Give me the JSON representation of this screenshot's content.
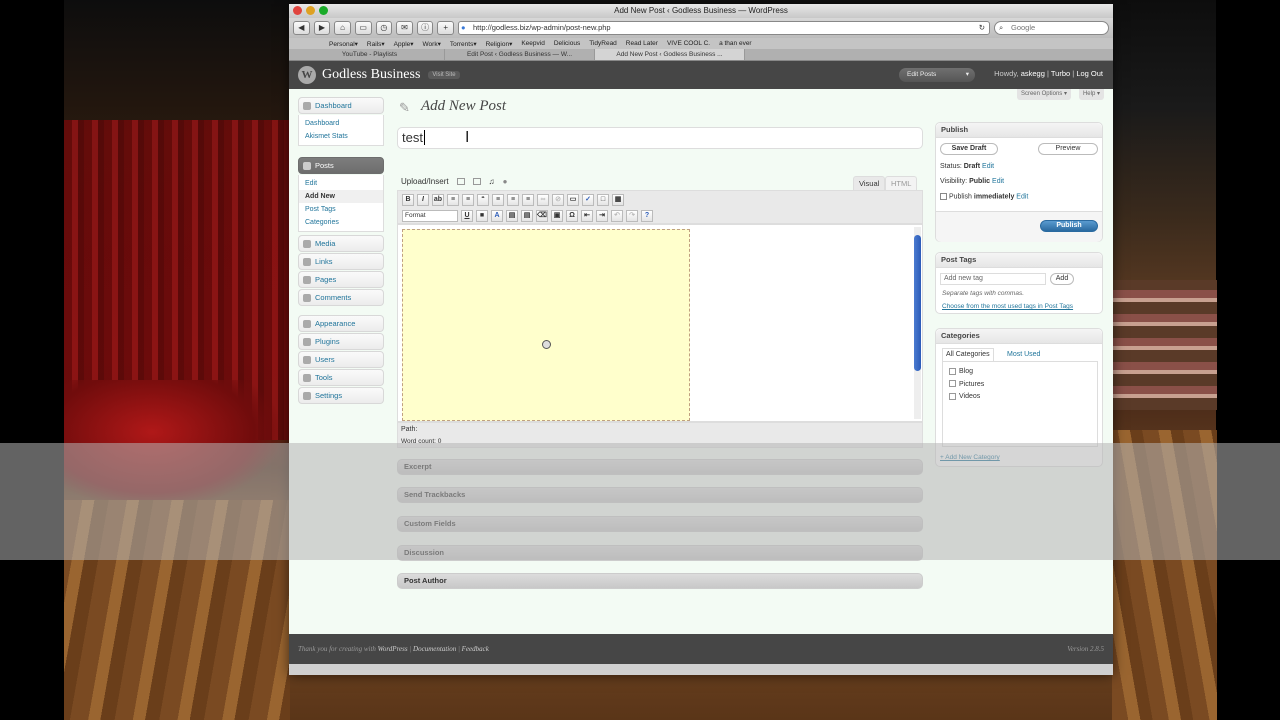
{
  "browser": {
    "window_title": "Add New Post ‹ Godless Business — WordPress",
    "url": "http://godless.biz/wp-admin/post-new.php",
    "search_placeholder": "Google",
    "bookmarks": [
      "Personal▾",
      "Rails▾",
      "Apple▾",
      "Work▾",
      "Torrents▾",
      "Religion▾",
      "Keepvid",
      "Delicious",
      "TidyRead",
      "Read Later",
      "VIVE COOL C.",
      "a than ever"
    ],
    "tabs": [
      "YouTube - Playlists",
      "Edit Post ‹ Godless Business — W...",
      "Add New Post ‹ Godless Business ..."
    ]
  },
  "wp_header": {
    "logo": "W",
    "site_name": "Godless Business",
    "visit_site": "Visit Site",
    "favorite_action": "Edit Posts",
    "howdy": "Howdy,",
    "user": "askegg",
    "turbo": "Turbo",
    "logout": "Log Out"
  },
  "screen_options": {
    "screen_options": "Screen Options ▾",
    "help": "Help ▾"
  },
  "menu": {
    "dashboard": "Dashboard",
    "dashboard_sub": [
      "Dashboard",
      "Akismet Stats"
    ],
    "posts": "Posts",
    "posts_sub": [
      "Edit",
      "Add New",
      "Post Tags",
      "Categories"
    ],
    "items_a": [
      "Media",
      "Links",
      "Pages",
      "Comments"
    ],
    "items_b": [
      "Appearance",
      "Plugins",
      "Users",
      "Tools",
      "Settings"
    ]
  },
  "editor": {
    "page_title": "Add New Post",
    "title_value": "test",
    "upload_insert": "Upload/Insert",
    "visual_tab": "Visual",
    "html_tab": "HTML",
    "format_select": "Format",
    "path_label": "Path:",
    "word_count": "Word count: 0"
  },
  "closed_boxes": [
    "Excerpt",
    "Send Trackbacks",
    "Custom Fields",
    "Discussion",
    "Post Author"
  ],
  "publish": {
    "title": "Publish",
    "save_draft": "Save Draft",
    "preview": "Preview",
    "status_label": "Status:",
    "status_value": "Draft",
    "edit": "Edit",
    "visibility_label": "Visibility:",
    "visibility_value": "Public",
    "publish_label": "Publish",
    "publish_value": "immediately",
    "publish_button": "Publish"
  },
  "tags": {
    "title": "Post Tags",
    "placeholder": "Add new tag",
    "add_button": "Add",
    "hint": "Separate tags with commas.",
    "choose": "Choose from the most used tags in Post Tags"
  },
  "categories": {
    "title": "Categories",
    "tab_all": "All Categories",
    "tab_used": "Most Used",
    "items": [
      "Blog",
      "Pictures",
      "Videos"
    ],
    "add_new": "+ Add New Category"
  },
  "footer": {
    "thanks": "Thank you for creating with",
    "wordpress": "WordPress",
    "documentation": "Documentation",
    "feedback": "Feedback",
    "version": "Version 2.8.5"
  }
}
